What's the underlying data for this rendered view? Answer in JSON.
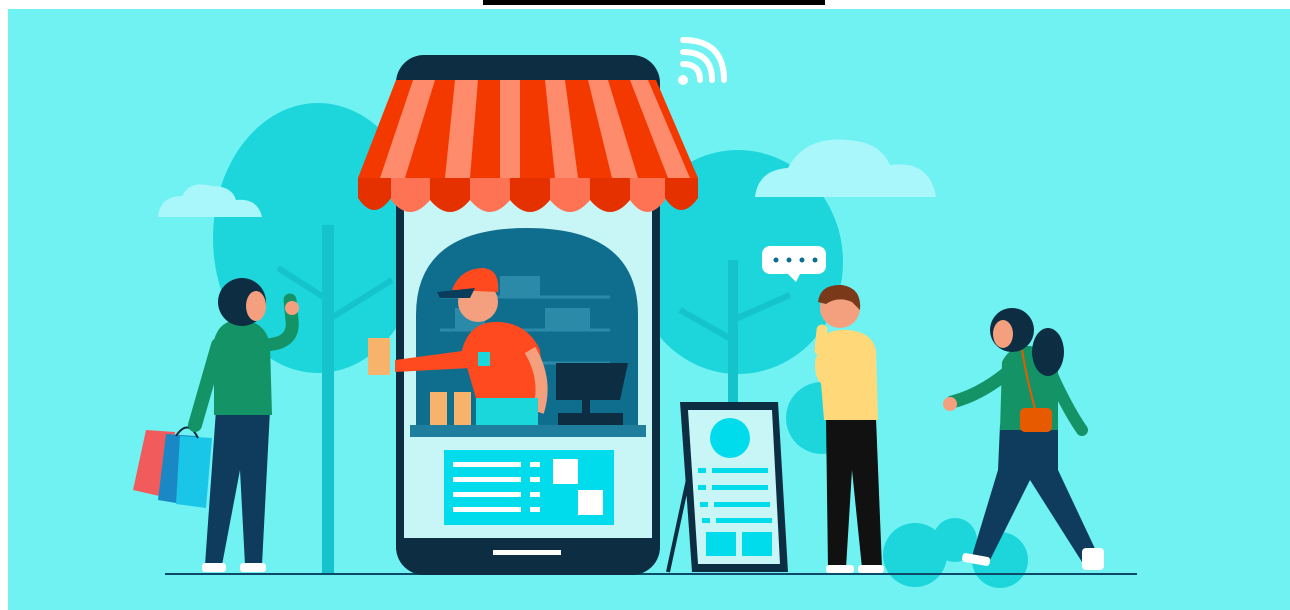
{
  "colors": {
    "background": "#70f2f2",
    "tree": "#1cd6dc",
    "cloud": "#a9f6fb",
    "awning_red": "#f33800",
    "awning_salmon": "#ff8b6d",
    "phone_bezel": "#0d2d43",
    "phone_screen": "#c8f6f7",
    "shop_interior": "#0f6e8e",
    "cyan_accent": "#00dcec",
    "top_bar": "#000000"
  },
  "icons": {
    "wifi": "wifi-icon",
    "chat": "speech-bubble-icon",
    "cart": "shopping-bags-icon"
  },
  "speech_bubble": {
    "dots": 4
  }
}
